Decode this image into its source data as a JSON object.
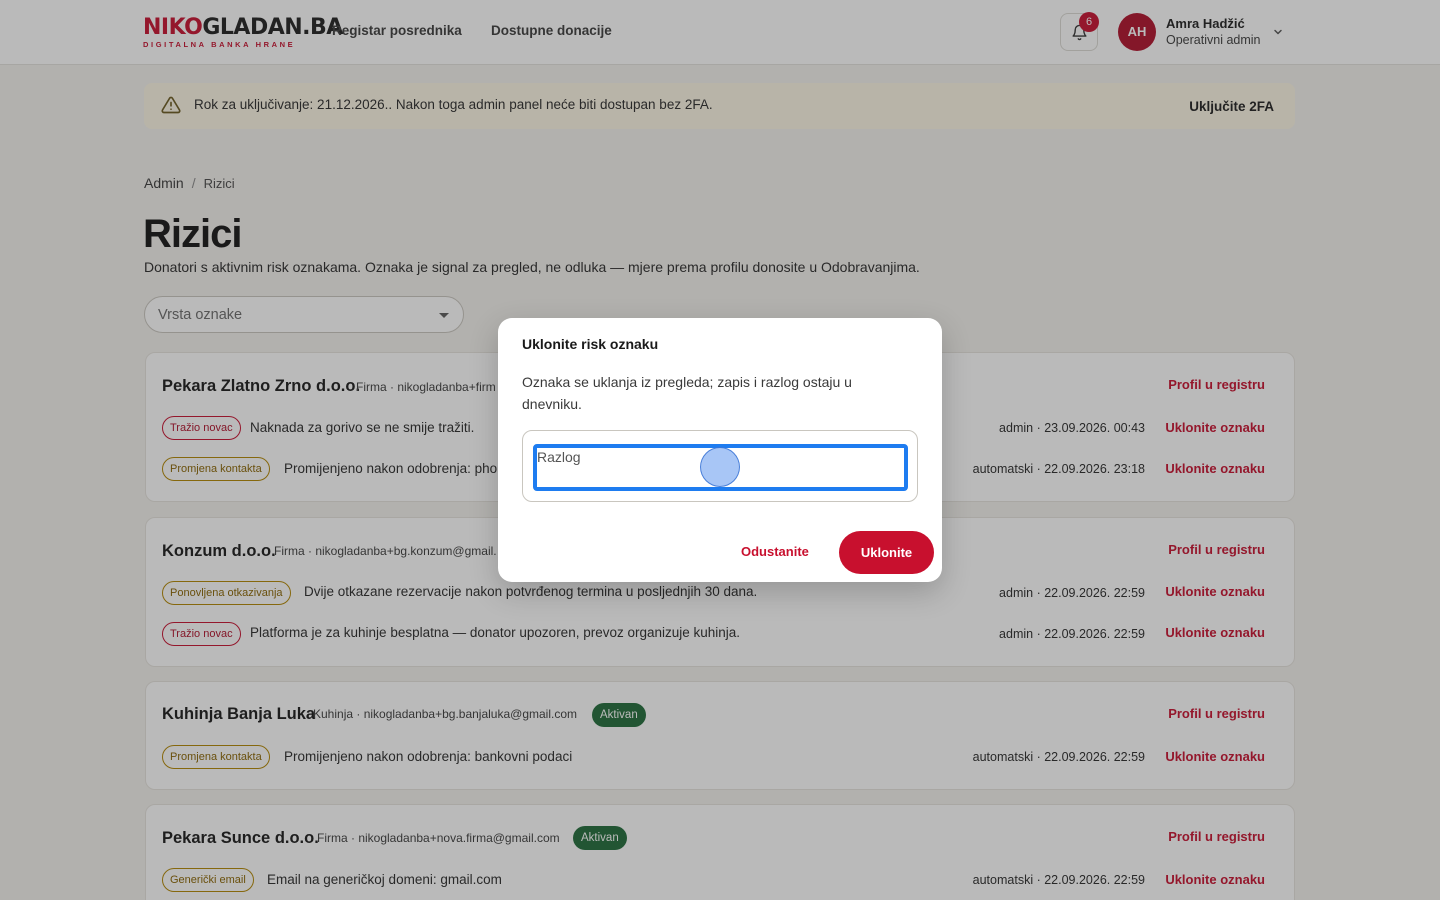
{
  "header": {
    "logo_main_red": "NIKO",
    "logo_main_dark": "GLADAN",
    "logo_main_red2": ".BA",
    "logo_sub": "DIGITALNA BANKA HRANE",
    "nav": [
      "Registar posrednika",
      "Dostupne donacije"
    ],
    "notifications_count": "6",
    "user_initials": "AH",
    "user_name": "Amra Hadžić",
    "user_role": "Operativni admin"
  },
  "banner": {
    "text": "Rok za uključivanje: 21.12.2026.. Nakon toga admin panel neće biti dostupan bez 2FA.",
    "action": "Uključite 2FA"
  },
  "breadcrumb": {
    "root": "Admin",
    "sep": "/",
    "current": "Rizici"
  },
  "page": {
    "title": "Rizici",
    "description": "Donatori s aktivnim risk oznakama. Oznaka je signal za pregled, ne odluka — mjere prema profilu donosite u Odobravanjima.",
    "filter_placeholder": "Vrsta oznake"
  },
  "cards": [
    {
      "name": "Pekara Zlatno Zrno d.o.o.",
      "meta": "Firma · nikogladanba+firm",
      "status": "",
      "profile_link": "Profil u registru",
      "flags": [
        {
          "tag": "Tražio novac",
          "tag_color": "red",
          "text": "Naknada za gorivo se ne smije tražiti.",
          "time": "admin · 23.09.2026. 00:43",
          "action": "Uklonite oznaku"
        },
        {
          "tag": "Promjena kontakta",
          "tag_color": "gold",
          "text": "Promijenjeno nakon odobrenja: phor",
          "time": "automatski · 22.09.2026. 23:18",
          "action": "Uklonite oznaku"
        }
      ]
    },
    {
      "name": "Konzum d.o.o.",
      "meta": "Firma · nikogladanba+bg.konzum@gmail.",
      "status": "",
      "profile_link": "Profil u registru",
      "flags": [
        {
          "tag": "Ponovljena otkazivanja",
          "tag_color": "gold",
          "text": "Dvije otkazane rezervacije nakon potvrđenog termina u posljednjih 30 dana.",
          "time": "admin · 22.09.2026. 22:59",
          "action": "Uklonite oznaku"
        },
        {
          "tag": "Tražio novac",
          "tag_color": "red",
          "text": "Platforma je za kuhinje besplatna — donator upozoren, prevoz organizuje kuhinja.",
          "time": "admin · 22.09.2026. 22:59",
          "action": "Uklonite oznaku"
        }
      ]
    },
    {
      "name": "Kuhinja Banja Luka",
      "meta": "Kuhinja · nikogladanba+bg.banjaluka@gmail.com",
      "status": "Aktivan",
      "profile_link": "Profil u registru",
      "flags": [
        {
          "tag": "Promjena kontakta",
          "tag_color": "gold",
          "text": "Promijenjeno nakon odobrenja: bankovni podaci",
          "time": "automatski · 22.09.2026. 22:59",
          "action": "Uklonite oznaku"
        }
      ]
    },
    {
      "name": "Pekara Sunce d.o.o.",
      "meta": "Firma · nikogladanba+nova.firma@gmail.com",
      "status": "Aktivan",
      "profile_link": "Profil u registru",
      "flags": [
        {
          "tag": "Generički email",
          "tag_color": "gold",
          "text": "Email na generičkoj domeni: gmail.com",
          "time": "automatski · 22.09.2026. 22:59",
          "action": "Uklonite oznaku"
        }
      ]
    }
  ],
  "modal": {
    "title": "Uklonite risk oznaku",
    "description": "Oznaka se uklanja iz pregleda; zapis i razlog ostaju u dnevniku.",
    "input_placeholder": "Razlog",
    "cancel": "Odustanite",
    "confirm": "Uklonite"
  }
}
